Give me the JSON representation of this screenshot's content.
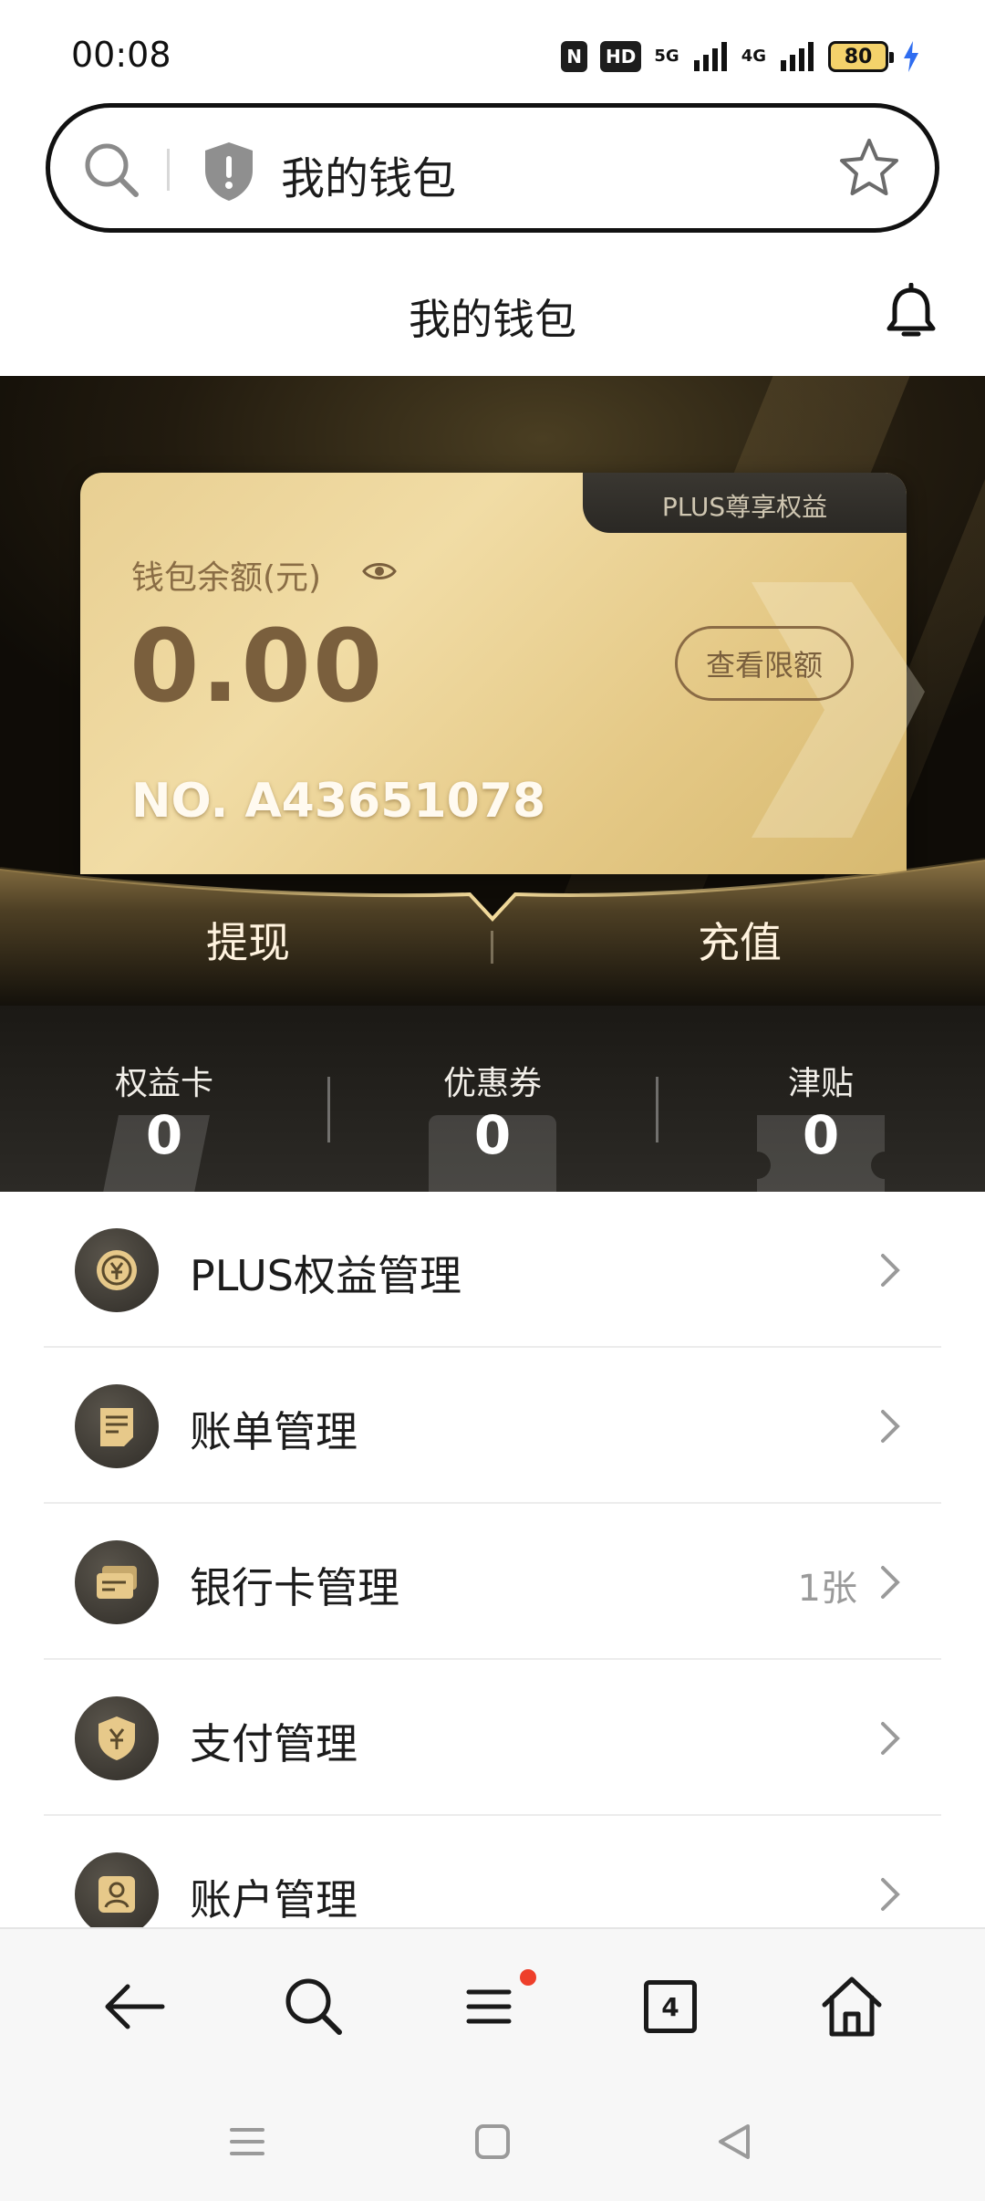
{
  "status_bar": {
    "time": "00:08",
    "nfc": "N",
    "hd": "HD",
    "net1": "5G",
    "net2": "4G",
    "battery": "80"
  },
  "address_bar": {
    "title": "我的钱包"
  },
  "header": {
    "title": "我的钱包"
  },
  "wallet": {
    "tab_label": "PLUS尊享权益",
    "balance_label": "钱包余额(元)",
    "balance": "0.00",
    "limit_button": "查看限额",
    "card_no": "NO. A43651078",
    "withdraw": "提现",
    "recharge": "充值"
  },
  "stats": [
    {
      "label": "权益卡",
      "value": "0"
    },
    {
      "label": "优惠券",
      "value": "0"
    },
    {
      "label": "津贴",
      "value": "0"
    }
  ],
  "menu": [
    {
      "label": "PLUS权益管理",
      "extra": ""
    },
    {
      "label": "账单管理",
      "extra": ""
    },
    {
      "label": "银行卡管理",
      "extra": "1张"
    },
    {
      "label": "支付管理",
      "extra": ""
    },
    {
      "label": "账户管理",
      "extra": ""
    }
  ],
  "browser_nav": {
    "tabs_count": "4"
  },
  "colors": {
    "gold": "#e8cf92",
    "gold_text": "#7a5f3d",
    "dark": "#1b1915",
    "badge_red": "#ee3f2b"
  },
  "icons": [
    "search-icon",
    "shield-icon",
    "star-icon",
    "bell-icon",
    "eye-icon",
    "chevron-right-icon",
    "back-icon",
    "menu-icon",
    "home-icon"
  ]
}
